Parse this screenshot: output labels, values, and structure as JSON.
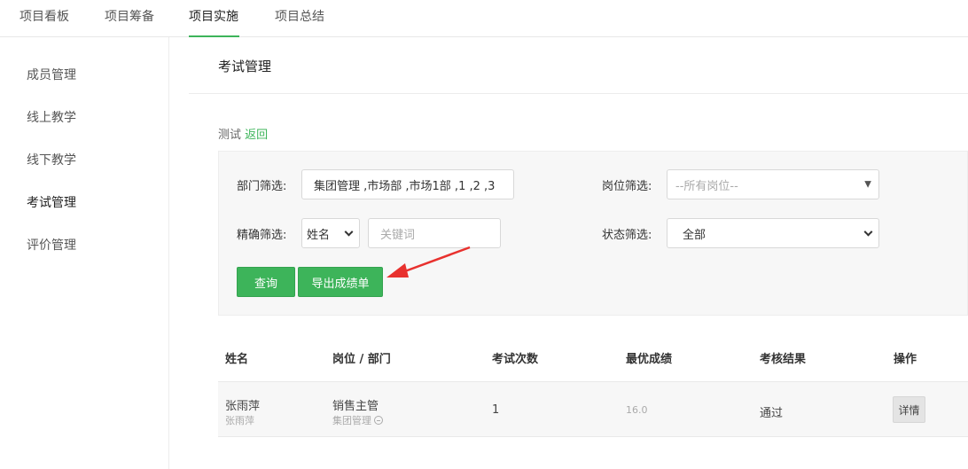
{
  "topnav": {
    "tabs": [
      {
        "label": "项目看板"
      },
      {
        "label": "项目筹备"
      },
      {
        "label": "项目实施"
      },
      {
        "label": "项目总结"
      }
    ],
    "active_index": 2,
    "accent_color": "#3db45a"
  },
  "sidebar": {
    "items": [
      {
        "label": "成员管理"
      },
      {
        "label": "线上教学"
      },
      {
        "label": "线下教学"
      },
      {
        "label": "考试管理"
      },
      {
        "label": "评价管理"
      }
    ],
    "active_index": 3
  },
  "main": {
    "title": "考试管理",
    "crumb": {
      "current": "测试",
      "back_label": "返回"
    },
    "filters": {
      "dept_label": "部门筛选:",
      "dept_value": "集团管理 ,市场部 ,市场1部 ,1 ,2 ,3",
      "post_label": "岗位筛选:",
      "post_placeholder": "--所有岗位--",
      "precise_label": "精确筛选:",
      "precise_field": "姓名",
      "keyword_placeholder": "关键词",
      "status_label": "状态筛选:",
      "status_value": "全部"
    },
    "buttons": {
      "query": "查询",
      "export": "导出成绩单"
    }
  },
  "table": {
    "headers": [
      "姓名",
      "岗位 / 部门",
      "考试次数",
      "最优成绩",
      "考核结果",
      "操作"
    ],
    "rows": [
      {
        "name": "张雨萍",
        "name_sub": "张雨萍",
        "post": "销售主管",
        "dept": "集团管理",
        "attempts": "1",
        "best_score": "16.0",
        "result": "通过",
        "action": "详情"
      }
    ]
  }
}
